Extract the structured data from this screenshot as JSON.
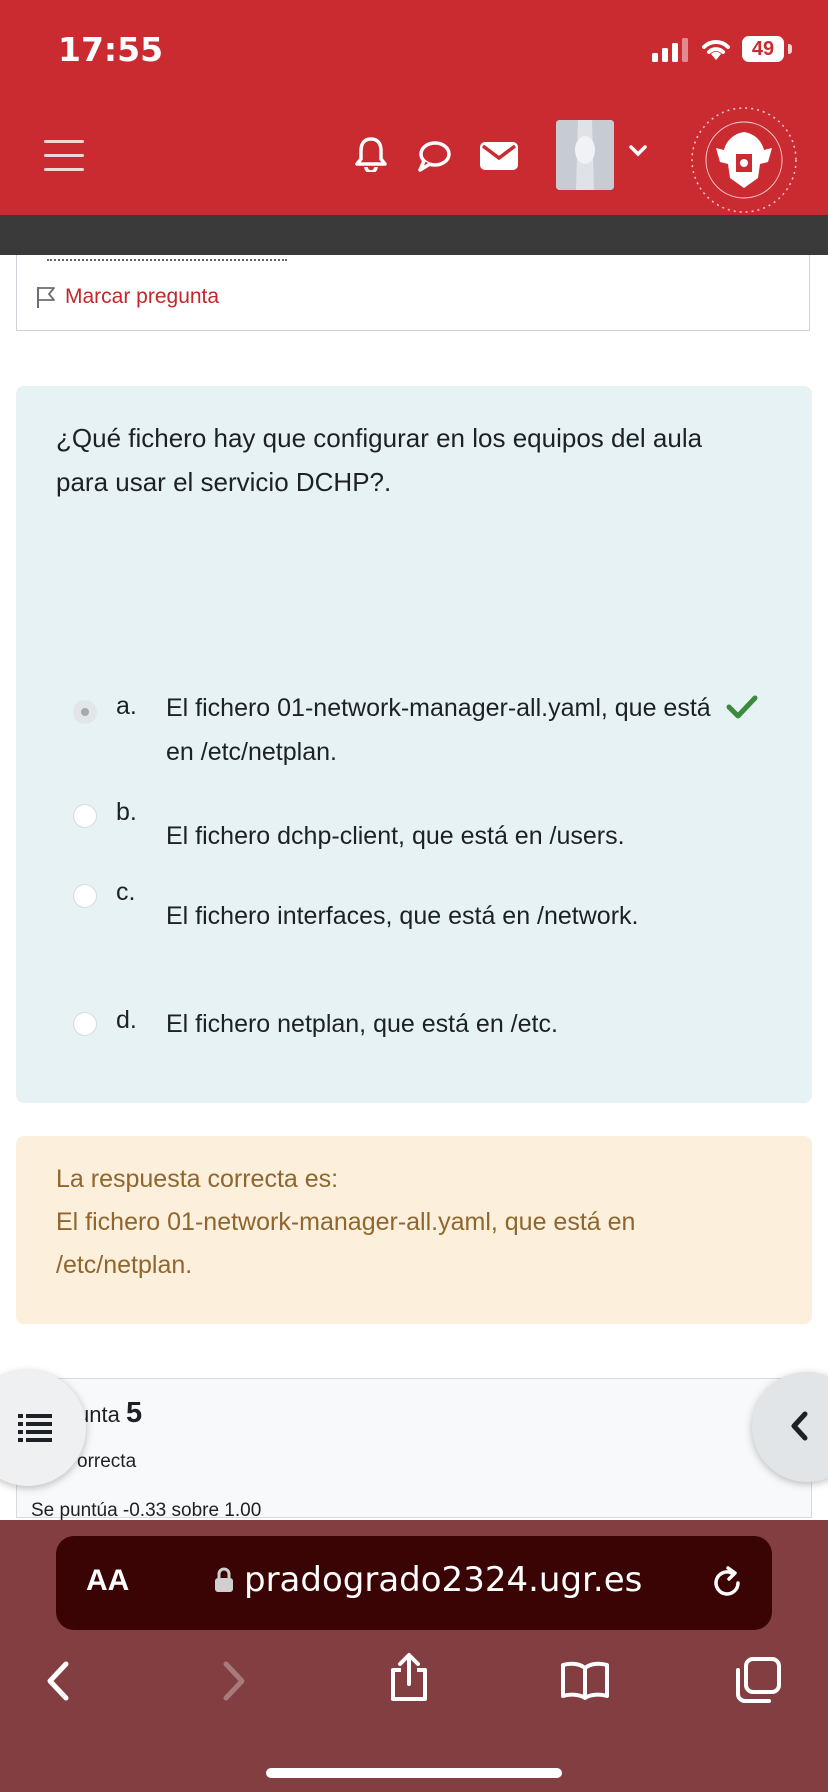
{
  "status_bar": {
    "time": "17:55",
    "battery": "49"
  },
  "header": {
    "menu_icon": "hamburger-icon",
    "notification_icon": "bell-icon",
    "messages_icon": "chat-bubble-icon",
    "mail_icon": "envelope-icon",
    "user_menu_icon": "chevron-down-icon",
    "logo_icon": "university-seal-icon"
  },
  "previous_question": {
    "flag_label": "Marcar pregunta"
  },
  "question": {
    "text": "¿Qué fichero hay que configurar en los equipos del aula para usar el servicio DCHP?.",
    "options": [
      {
        "letter": "a.",
        "text": "El fichero 01-network-manager-all.yaml, que está en /etc/netplan.",
        "selected": true,
        "correct": true
      },
      {
        "letter": "b.",
        "text": "El fichero dchp-client, que está en /users.",
        "selected": false
      },
      {
        "letter": "c.",
        "text": "El fichero interfaces, que está en /network.",
        "selected": false
      },
      {
        "letter": "d.",
        "text": "El fichero netplan, que está en /etc.",
        "selected": false
      }
    ]
  },
  "feedback": {
    "label": "La respuesta correcta es:",
    "answer": "El fichero 01-network-manager-all.yaml, que está en /etc/netplan."
  },
  "next_question": {
    "title_prefix": "unta",
    "number": "5",
    "status": "orrecta",
    "grade": "Se puntúa -0.33 sobre 1.00"
  },
  "browser": {
    "aa_label": "AA",
    "url": "pradogrado2324.ugr.es"
  },
  "colors": {
    "brand_red": "#ca2b30",
    "safari_bar": "#823e40",
    "check_green": "#3b8a3e",
    "feedback_text": "#8e662e"
  }
}
